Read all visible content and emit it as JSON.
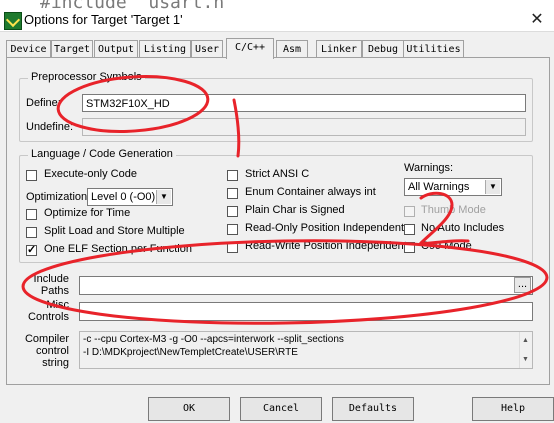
{
  "background_code": "#include \"usart.h\"",
  "window": {
    "title": "Options for Target 'Target 1'",
    "close": "✕"
  },
  "tabs": [
    "Device",
    "Target",
    "Output",
    "Listing",
    "User",
    "C/C++",
    "Asm",
    "Linker",
    "Debug",
    "Utilities"
  ],
  "active_tab": "C/C++",
  "preprocessor": {
    "group_title": "Preprocessor Symbols",
    "define_label": "Define:",
    "define_value": "STM32F10X_HD",
    "undefine_label": "Undefine:",
    "undefine_value": ""
  },
  "language": {
    "group_title": "Language / Code Generation",
    "execute_only": {
      "label": "Execute-only Code",
      "checked": false
    },
    "optimization_label": "Optimization:",
    "optimization_value": "Level 0 (-O0)",
    "optimize_time": {
      "label": "Optimize for Time",
      "checked": false
    },
    "split_load": {
      "label": "Split Load and Store Multiple",
      "checked": false
    },
    "one_elf": {
      "label": "One ELF Section per Function",
      "checked": true
    },
    "strict_ansi": {
      "label": "Strict ANSI C",
      "checked": false
    },
    "enum_container": {
      "label": "Enum Container always int",
      "checked": false
    },
    "plain_char": {
      "label": "Plain Char is Signed",
      "checked": false
    },
    "ropi": {
      "label": "Read-Only Position Independent",
      "checked": false
    },
    "rwpi": {
      "label": "Read-Write Position Independent",
      "checked": false
    },
    "warnings_label": "Warnings:",
    "warnings_value": "All Warnings",
    "thumb_mode": {
      "label": "Thumb Mode",
      "checked": false,
      "disabled": true
    },
    "no_auto_includes": {
      "label": "No Auto Includes",
      "checked": false
    },
    "c99_mode": {
      "label": "C99 Mode",
      "checked": false
    }
  },
  "include": {
    "label_line1": "Include",
    "label_line2": "Paths",
    "value": "",
    "browse": "..."
  },
  "misc": {
    "label_line1": "Misc",
    "label_line2": "Controls",
    "value": ""
  },
  "compiler": {
    "label_line1": "Compiler",
    "label_line2": "control",
    "label_line3": "string",
    "line1": "-c --cpu Cortex-M3 -g -O0 --apcs=interwork --split_sections",
    "line2": "-I D:\\MDKproject\\NewTempletCreate\\USER\\RTE"
  },
  "buttons": {
    "ok": "OK",
    "cancel": "Cancel",
    "defaults": "Defaults",
    "help": "Help"
  },
  "annotations": {
    "mark1": "1",
    "mark2": "2",
    "color": "#e8232a"
  }
}
